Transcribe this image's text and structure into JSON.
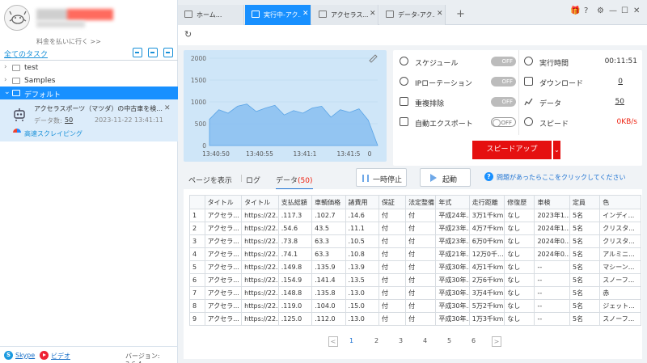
{
  "sidebar": {
    "pay_link": "料金を払いに行く >>",
    "all_tasks": "全てのタスク",
    "folders": [
      {
        "label": "test"
      },
      {
        "label": "Samples"
      },
      {
        "label": "デフォルト"
      }
    ],
    "task": {
      "title": "アクセラスポーツ（マツダ）の中古車を検...",
      "count_label": "データ数:",
      "count": "50",
      "time": "2023-11-22 13:41:11",
      "mode": "高速スクレイピング"
    },
    "footer": {
      "skype": "Skype",
      "video": "ビデオ",
      "version": "バージョン: 3.6.4"
    }
  },
  "tabs": [
    {
      "label": "ホーム..."
    },
    {
      "label": "実行中-アク...",
      "active": true
    },
    {
      "label": "アクセラス..."
    },
    {
      "label": "データ-アク..."
    }
  ],
  "tab_add": "+",
  "window_controls": [
    "🎁",
    "?",
    "⚙",
    "—",
    "☐",
    "✕"
  ],
  "chart_data": {
    "type": "area",
    "x_ticks": [
      "13:40:50",
      "13:40:55",
      "13:41:1",
      "13:41:5",
      "0"
    ],
    "y_ticks": [
      0,
      500,
      1000,
      1500,
      2000
    ],
    "ylim": [
      0,
      2000
    ],
    "color": "#7fbaf0",
    "values": [
      600,
      820,
      740,
      900,
      950,
      780,
      860,
      920,
      700,
      800,
      740,
      860,
      900,
      650,
      820,
      760,
      840,
      580,
      0
    ]
  },
  "settings": {
    "schedule": {
      "label": "スケジュール",
      "state": "OFF"
    },
    "ip_rotation": {
      "label": "IPローテーション",
      "state": "OFF"
    },
    "dedup": {
      "label": "重複排除",
      "state": "OFF"
    },
    "auto_export": {
      "label": "自動エクスポート",
      "state": "OFF"
    },
    "run_time": {
      "label": "実行時間",
      "value": "00:11:51"
    },
    "download": {
      "label": "ダウンロード",
      "value": "0"
    },
    "data": {
      "label": "データ",
      "value": "50"
    },
    "speed": {
      "label": "スピード",
      "value": "0KB/s"
    },
    "speedup_label": "スピードアップ"
  },
  "data_tabs": {
    "page_view": "ページを表示",
    "log": "ログ",
    "data": "データ",
    "data_count": "(50)",
    "pause": "一時停止",
    "start": "起動",
    "help": "問題があったらここをクリックしてください"
  },
  "table": {
    "headers": [
      "",
      "タイトル",
      "タイトル",
      "支払総額",
      "車輌価格",
      "諸費用",
      "保証",
      "法定整備",
      "年式",
      "走行距離",
      "修復歴",
      "車検",
      "定員",
      "色"
    ],
    "rows": [
      [
        "1",
        "アクセラ...",
        "https://22...",
        ".117.3",
        ".102.7",
        ".14.6",
        "付",
        "付",
        "平成24年...",
        "3万1千km",
        "なし",
        "2023年1...",
        "5名",
        "インディ..."
      ],
      [
        "2",
        "アクセラ...",
        "https://22...",
        ".54.6",
        "43.5",
        ".11.1",
        "付",
        "付",
        "平成23年...",
        "4万7千km",
        "なし",
        "2024年1...",
        "5名",
        "クリスタ..."
      ],
      [
        "3",
        "アクセラ...",
        "https://22...",
        ".73.8",
        "63.3",
        ".10.5",
        "付",
        "付",
        "平成23年...",
        "6万0千km",
        "なし",
        "2024年0...",
        "5名",
        "クリスタ..."
      ],
      [
        "4",
        "アクセラ...",
        "https://22...",
        ".74.1",
        "63.3",
        ".10.8",
        "付",
        "付",
        "平成21年...",
        "12万0千...",
        "なし",
        "2024年0...",
        "5名",
        "アルミニ..."
      ],
      [
        "5",
        "アクセラ...",
        "https://22...",
        ".149.8",
        ".135.9",
        ".13.9",
        "付",
        "付",
        "平成30年...",
        "4万1千km",
        "なし",
        "--",
        "5名",
        "マシーン..."
      ],
      [
        "6",
        "アクセラ...",
        "https://22...",
        ".154.9",
        ".141.4",
        ".13.5",
        "付",
        "付",
        "平成30年...",
        "2万6千km",
        "なし",
        "--",
        "5名",
        "スノーフ..."
      ],
      [
        "7",
        "アクセラ...",
        "https://22...",
        ".148.8",
        ".135.8",
        ".13.0",
        "付",
        "付",
        "平成30年...",
        "3万4千km",
        "なし",
        "--",
        "5名",
        "赤"
      ],
      [
        "8",
        "アクセラ...",
        "https://22...",
        ".119.0",
        ".104.0",
        ".15.0",
        "付",
        "付",
        "平成30年...",
        "5万2千km",
        "なし",
        "--",
        "5名",
        "ジェット..."
      ],
      [
        "9",
        "アクセラ...",
        "https://22...",
        ".125.0",
        ".112.0",
        ".13.0",
        "付",
        "付",
        "平成30年...",
        "1万3千km",
        "なし",
        "--",
        "5名",
        "スノーフ..."
      ]
    ]
  },
  "pagination": {
    "prev": "<",
    "next": ">",
    "pages": [
      "1",
      "2",
      "3",
      "4",
      "5",
      "6"
    ],
    "current": "1"
  }
}
